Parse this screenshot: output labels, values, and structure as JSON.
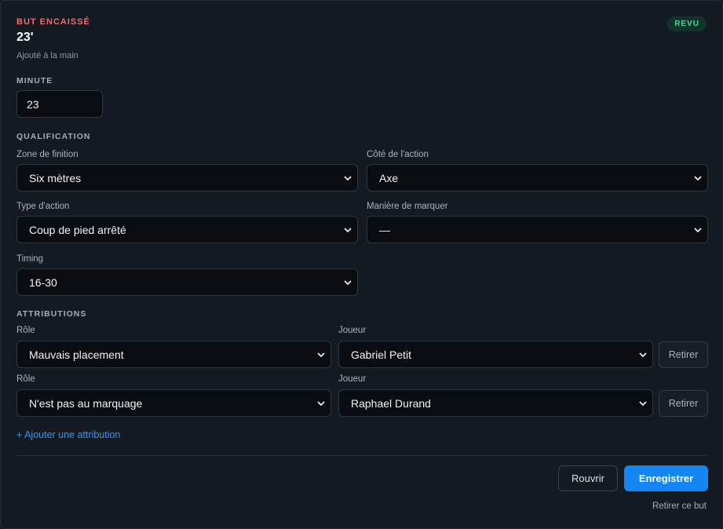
{
  "header": {
    "eyebrow": "BUT ENCAISSÉ",
    "minute_display": "23'",
    "source": "Ajouté à la main",
    "status_badge": "REVU"
  },
  "minute": {
    "section_label": "MINUTE",
    "value": "23"
  },
  "qualification": {
    "section_label": "QUALIFICATION",
    "zone": {
      "label": "Zone de finition",
      "value": "Six mètres"
    },
    "side": {
      "label": "Côté de l'action",
      "value": "Axe"
    },
    "action_type": {
      "label": "Type d'action",
      "value": "Coup de pied arrêté"
    },
    "scoring_manner": {
      "label": "Manière de marquer",
      "value": "—"
    },
    "timing": {
      "label": "Timing",
      "value": "16-30"
    }
  },
  "attributions": {
    "section_label": "ATTRIBUTIONS",
    "role_label": "Rôle",
    "player_label": "Joueur",
    "remove_label": "Retirer",
    "rows": [
      {
        "role": "Mauvais placement",
        "player": "Gabriel Petit"
      },
      {
        "role": "N'est pas au marquage",
        "player": "Raphael Durand"
      }
    ],
    "add_link": "+ Ajouter une attribution"
  },
  "footer": {
    "reset_label": "Rouvrir",
    "save_label": "Enregistrer",
    "remove_goal_label": "Retirer ce but"
  }
}
